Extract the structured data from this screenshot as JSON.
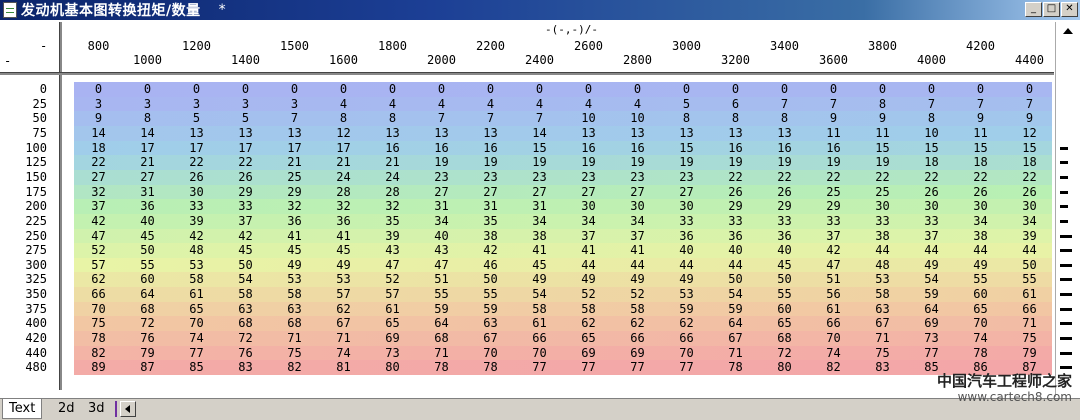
{
  "window": {
    "title": "发动机基本图转换扭矩/数量",
    "modified_marker": "*",
    "btn_minimize": "_",
    "btn_maximize": "□",
    "btn_close": "✕"
  },
  "header": {
    "column_unit": "-(-,-)/-",
    "corner_top": "-",
    "corner_bottom": "-"
  },
  "table": {
    "columns": [
      "800",
      "1000",
      "1200",
      "1400",
      "1500",
      "1600",
      "1800",
      "2000",
      "2200",
      "2400",
      "2600",
      "2800",
      "3000",
      "3200",
      "3400",
      "3600",
      "3800",
      "4000",
      "4200",
      "4400"
    ],
    "rows": [
      "0",
      "25",
      "50",
      "75",
      "100",
      "125",
      "150",
      "175",
      "200",
      "225",
      "250",
      "275",
      "300",
      "325",
      "350",
      "375",
      "400",
      "420",
      "440",
      "480"
    ],
    "values": [
      [
        0,
        0,
        0,
        0,
        0,
        0,
        0,
        0,
        0,
        0,
        0,
        0,
        0,
        0,
        0,
        0,
        0,
        0,
        0,
        0
      ],
      [
        3,
        3,
        3,
        3,
        3,
        4,
        4,
        4,
        4,
        4,
        4,
        4,
        5,
        6,
        7,
        7,
        8,
        7,
        7,
        7
      ],
      [
        9,
        8,
        5,
        5,
        7,
        8,
        8,
        7,
        7,
        7,
        10,
        10,
        8,
        8,
        8,
        9,
        9,
        8,
        9,
        9
      ],
      [
        14,
        14,
        13,
        13,
        13,
        12,
        13,
        13,
        13,
        14,
        13,
        13,
        13,
        13,
        13,
        11,
        11,
        10,
        11,
        12
      ],
      [
        18,
        17,
        17,
        17,
        17,
        17,
        16,
        16,
        16,
        15,
        16,
        16,
        15,
        16,
        16,
        16,
        15,
        15,
        15,
        15
      ],
      [
        22,
        21,
        22,
        22,
        21,
        21,
        21,
        19,
        19,
        19,
        19,
        19,
        19,
        19,
        19,
        19,
        19,
        18,
        18,
        18
      ],
      [
        27,
        27,
        26,
        26,
        25,
        24,
        24,
        23,
        23,
        23,
        23,
        23,
        23,
        22,
        22,
        22,
        22,
        22,
        22,
        22
      ],
      [
        32,
        31,
        30,
        29,
        29,
        28,
        28,
        27,
        27,
        27,
        27,
        27,
        27,
        26,
        26,
        25,
        25,
        26,
        26,
        26
      ],
      [
        37,
        36,
        33,
        33,
        32,
        32,
        32,
        31,
        31,
        31,
        30,
        30,
        30,
        29,
        29,
        29,
        30,
        30,
        30,
        30
      ],
      [
        42,
        40,
        39,
        37,
        36,
        36,
        35,
        34,
        35,
        34,
        34,
        34,
        33,
        33,
        33,
        33,
        33,
        33,
        34,
        34
      ],
      [
        47,
        45,
        42,
        42,
        41,
        41,
        39,
        40,
        38,
        38,
        37,
        37,
        36,
        36,
        36,
        37,
        38,
        37,
        38,
        39
      ],
      [
        52,
        50,
        48,
        45,
        45,
        45,
        43,
        43,
        42,
        41,
        41,
        41,
        40,
        40,
        40,
        42,
        44,
        44,
        44,
        44
      ],
      [
        57,
        55,
        53,
        50,
        49,
        49,
        47,
        47,
        46,
        45,
        44,
        44,
        44,
        44,
        45,
        47,
        48,
        49,
        49,
        50
      ],
      [
        62,
        60,
        58,
        54,
        53,
        53,
        52,
        51,
        50,
        49,
        49,
        49,
        49,
        50,
        50,
        51,
        53,
        54,
        55,
        55
      ],
      [
        66,
        64,
        61,
        58,
        58,
        57,
        57,
        55,
        55,
        54,
        52,
        52,
        53,
        54,
        55,
        56,
        58,
        59,
        60,
        61
      ],
      [
        70,
        68,
        65,
        63,
        63,
        62,
        61,
        59,
        59,
        58,
        58,
        58,
        59,
        59,
        60,
        61,
        63,
        64,
        65,
        66
      ],
      [
        75,
        72,
        70,
        68,
        68,
        67,
        65,
        64,
        63,
        61,
        62,
        62,
        62,
        64,
        65,
        66,
        67,
        69,
        70,
        71
      ],
      [
        78,
        76,
        74,
        72,
        71,
        71,
        69,
        68,
        67,
        66,
        65,
        66,
        66,
        67,
        68,
        70,
        71,
        73,
        74,
        75
      ],
      [
        82,
        79,
        77,
        76,
        75,
        74,
        73,
        71,
        70,
        70,
        69,
        69,
        70,
        71,
        72,
        74,
        75,
        77,
        78,
        79
      ],
      [
        89,
        87,
        85,
        83,
        82,
        81,
        80,
        78,
        78,
        77,
        77,
        77,
        77,
        78,
        80,
        82,
        83,
        85,
        86,
        87
      ]
    ]
  },
  "colors": {
    "row_gradient": [
      "#a9b3f2",
      "#9fd0e9",
      "#b9f0b3",
      "#e8f4a6",
      "#f2c9a3",
      "#f3a6a8"
    ]
  },
  "tabs": [
    {
      "label": "Text"
    },
    {
      "label": "2d"
    },
    {
      "label": "3d"
    }
  ],
  "watermark": {
    "cn": "中国汽车工程师之家",
    "url": "www.cartech8.com"
  }
}
